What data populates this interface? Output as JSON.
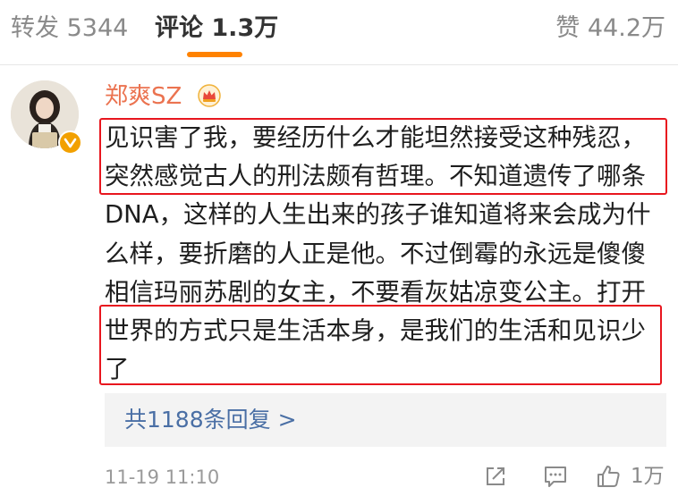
{
  "tabs": {
    "repost": "转发 5344",
    "comment": "评论 1.3万",
    "like": "赞 44.2万"
  },
  "comment": {
    "username": "郑爽SZ",
    "text": "见识害了我，要经历什么才能坦然接受这种残忍，突然感觉古人的刑法颇有哲理。不知道遗传了哪条DNA，这样的人生出来的孩子谁知道将来会成为什么样，要折磨的人正是他。不过倒霉的永远是傻傻相信玛丽苏剧的女主，不要看灰姑凉变公主。打开世界的方式只是生活本身，是我们的生活和见识少了",
    "replies_link": "共1188条回复 >",
    "timestamp": "11-19 11:10",
    "like_count": "1万"
  },
  "icons": [
    "crown-icon",
    "verified-icon",
    "share-icon",
    "reply-icon",
    "like-icon"
  ],
  "colors": {
    "accent_orange": "#ff8200",
    "username": "#eb7350",
    "highlight_red": "#e8161e",
    "link_blue": "#4a6fa5"
  }
}
